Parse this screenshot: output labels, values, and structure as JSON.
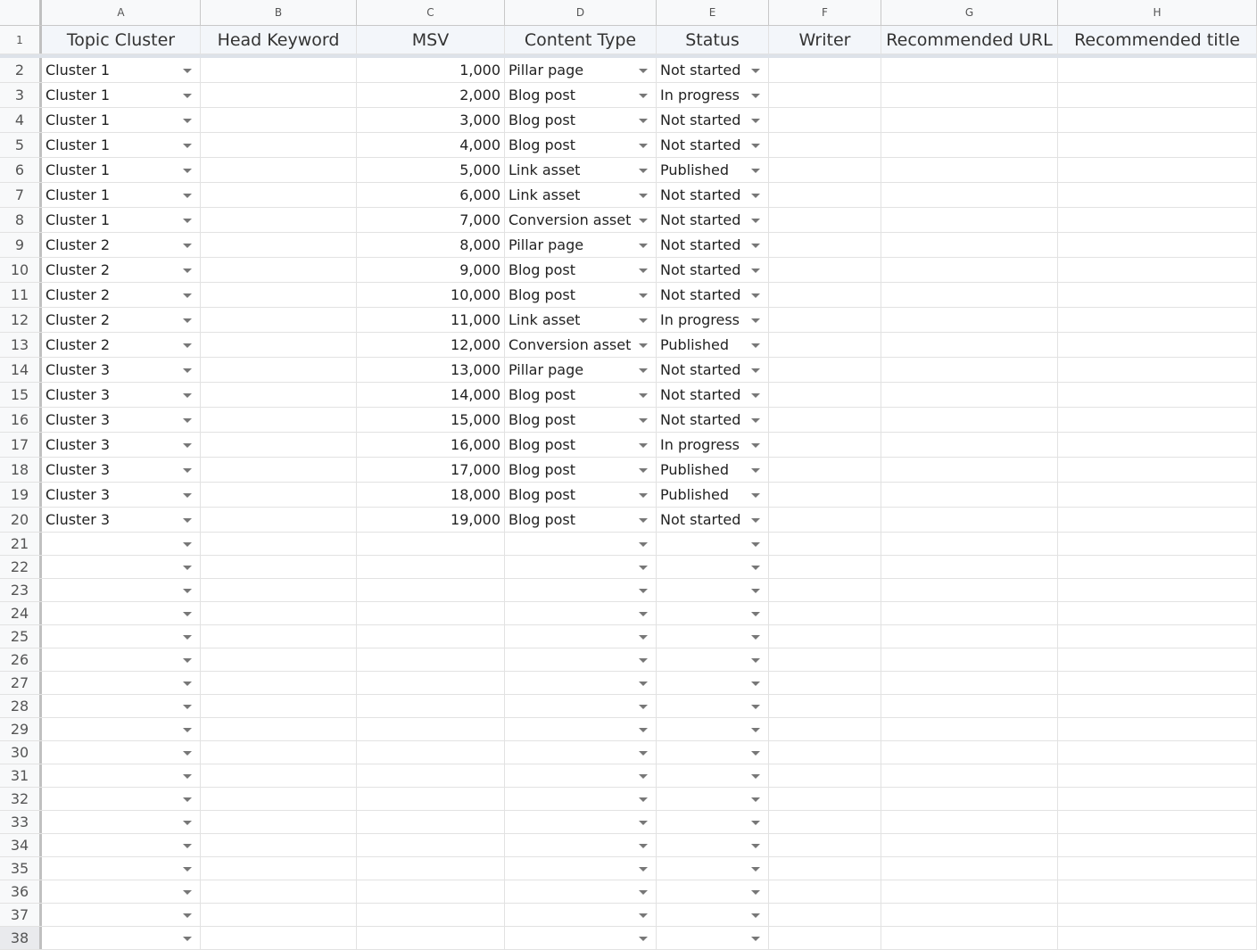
{
  "column_letters": [
    "A",
    "B",
    "C",
    "D",
    "E",
    "F",
    "G",
    "H"
  ],
  "header_row": {
    "row_number": "1",
    "labels": [
      "Topic Cluster",
      "Head Keyword",
      "MSV",
      "Content Type",
      "Status",
      "Writer",
      "Recommended URL",
      "Recommended title"
    ]
  },
  "rows": [
    {
      "n": "2",
      "cluster": "Cluster 1",
      "keyword": "",
      "msv": "1,000",
      "type": "Pillar page",
      "status": "Not started"
    },
    {
      "n": "3",
      "cluster": "Cluster 1",
      "keyword": "",
      "msv": "2,000",
      "type": "Blog post",
      "status": "In progress"
    },
    {
      "n": "4",
      "cluster": "Cluster 1",
      "keyword": "",
      "msv": "3,000",
      "type": "Blog post",
      "status": "Not started"
    },
    {
      "n": "5",
      "cluster": "Cluster 1",
      "keyword": "",
      "msv": "4,000",
      "type": "Blog post",
      "status": "Not started"
    },
    {
      "n": "6",
      "cluster": "Cluster 1",
      "keyword": "",
      "msv": "5,000",
      "type": "Link asset",
      "status": "Published"
    },
    {
      "n": "7",
      "cluster": "Cluster 1",
      "keyword": "",
      "msv": "6,000",
      "type": "Link asset",
      "status": "Not started"
    },
    {
      "n": "8",
      "cluster": "Cluster 1",
      "keyword": "",
      "msv": "7,000",
      "type": "Conversion asset",
      "status": "Not started"
    },
    {
      "n": "9",
      "cluster": "Cluster 2",
      "keyword": "",
      "msv": "8,000",
      "type": "Pillar page",
      "status": "Not started"
    },
    {
      "n": "10",
      "cluster": "Cluster 2",
      "keyword": "",
      "msv": "9,000",
      "type": "Blog post",
      "status": "Not started"
    },
    {
      "n": "11",
      "cluster": "Cluster 2",
      "keyword": "",
      "msv": "10,000",
      "type": "Blog post",
      "status": "Not started"
    },
    {
      "n": "12",
      "cluster": "Cluster 2",
      "keyword": "",
      "msv": "11,000",
      "type": "Link asset",
      "status": "In progress"
    },
    {
      "n": "13",
      "cluster": "Cluster 2",
      "keyword": "",
      "msv": "12,000",
      "type": "Conversion asset",
      "status": "Published"
    },
    {
      "n": "14",
      "cluster": "Cluster 3",
      "keyword": "",
      "msv": "13,000",
      "type": "Pillar page",
      "status": "Not started"
    },
    {
      "n": "15",
      "cluster": "Cluster 3",
      "keyword": "",
      "msv": "14,000",
      "type": "Blog post",
      "status": "Not started"
    },
    {
      "n": "16",
      "cluster": "Cluster 3",
      "keyword": "",
      "msv": "15,000",
      "type": "Blog post",
      "status": "Not started"
    },
    {
      "n": "17",
      "cluster": "Cluster 3",
      "keyword": "",
      "msv": "16,000",
      "type": "Blog post",
      "status": "In progress"
    },
    {
      "n": "18",
      "cluster": "Cluster 3",
      "keyword": "",
      "msv": "17,000",
      "type": "Blog post",
      "status": "Published"
    },
    {
      "n": "19",
      "cluster": "Cluster 3",
      "keyword": "",
      "msv": "18,000",
      "type": "Blog post",
      "status": "Published"
    },
    {
      "n": "20",
      "cluster": "Cluster 3",
      "keyword": "",
      "msv": "19,000",
      "type": "Blog post",
      "status": "Not started"
    }
  ],
  "empty_rows": [
    "21",
    "22",
    "23",
    "24",
    "25",
    "26",
    "27",
    "28",
    "29",
    "30",
    "31",
    "32",
    "33",
    "34",
    "35",
    "36",
    "37",
    "38"
  ]
}
